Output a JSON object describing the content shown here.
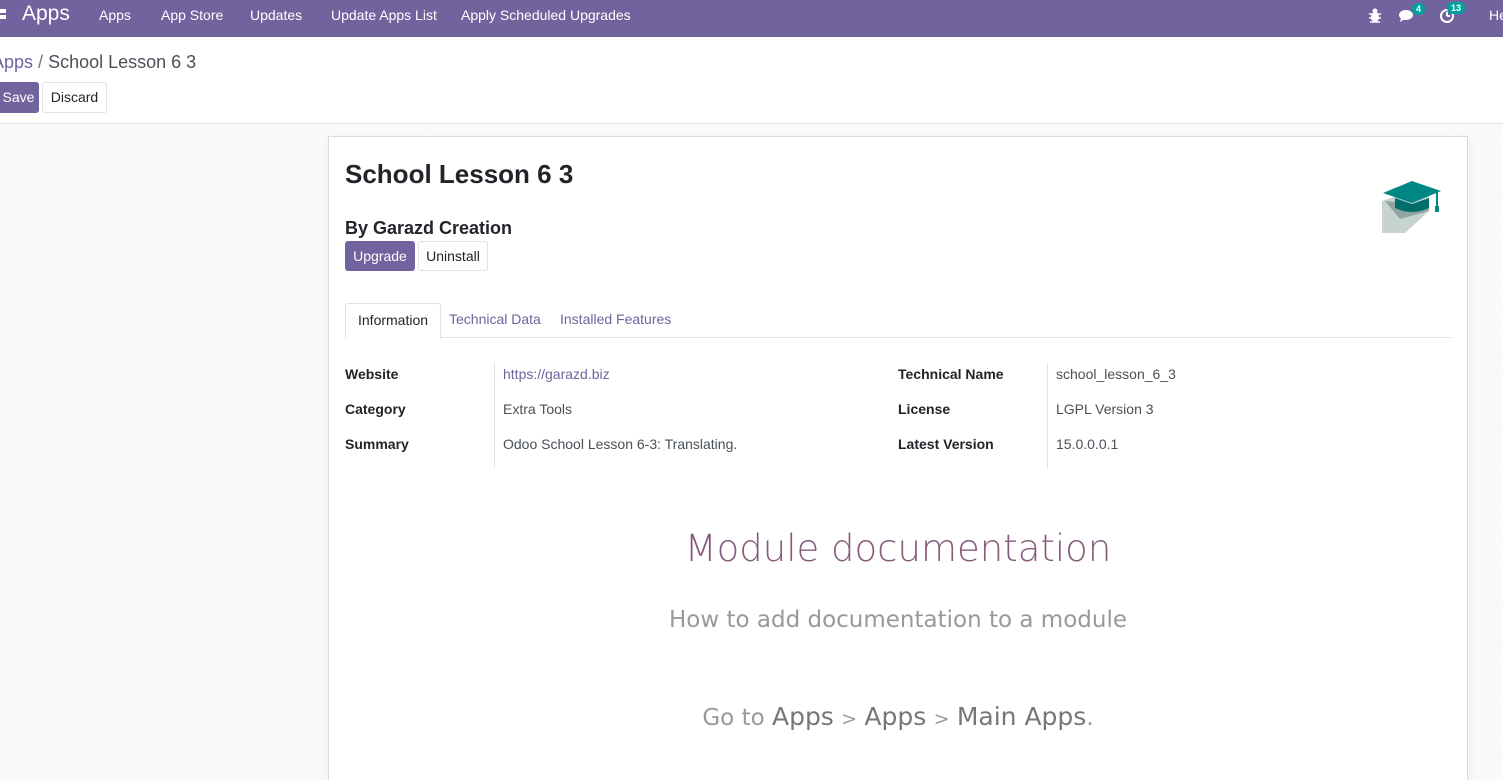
{
  "navbar": {
    "app_name": "Apps",
    "menu": [
      "Apps",
      "App Store",
      "Updates",
      "Update Apps List",
      "Apply Scheduled Upgrades"
    ],
    "messages_count": "4",
    "activities_count": "13",
    "user_initials": "He"
  },
  "breadcrumb": {
    "parent": "Apps",
    "separator": "/",
    "current": "School Lesson 6 3"
  },
  "actions": {
    "save": "Save",
    "discard": "Discard"
  },
  "module": {
    "title": "School Lesson 6 3",
    "author": "By Garazd Creation",
    "icon": "graduation-cap-icon",
    "icon_color": "#008784",
    "upgrade": "Upgrade",
    "uninstall": "Uninstall"
  },
  "tabs": [
    "Information",
    "Technical Data",
    "Installed Features"
  ],
  "info": {
    "left": [
      {
        "label": "Website",
        "value": "https://garazd.biz"
      },
      {
        "label": "Category",
        "value": "Extra Tools"
      },
      {
        "label": "Summary",
        "value": "Odoo School Lesson 6-3: Translating."
      }
    ],
    "right": [
      {
        "label": "Technical Name",
        "value": "school_lesson_6_3"
      },
      {
        "label": "License",
        "value": "LGPL Version 3"
      },
      {
        "label": "Latest Version",
        "value": "15.0.0.0.1"
      }
    ]
  },
  "doc": {
    "title": "Module documentation",
    "subtitle": "How to add documentation to a module",
    "go_to": "Go to",
    "path": [
      "Apps",
      "Apps",
      "Main Apps"
    ],
    "path_sep": ">",
    "end": "."
  },
  "colors": {
    "brand": "#71639e",
    "doc_title": "#875a7b",
    "badge": "#00a09d"
  }
}
